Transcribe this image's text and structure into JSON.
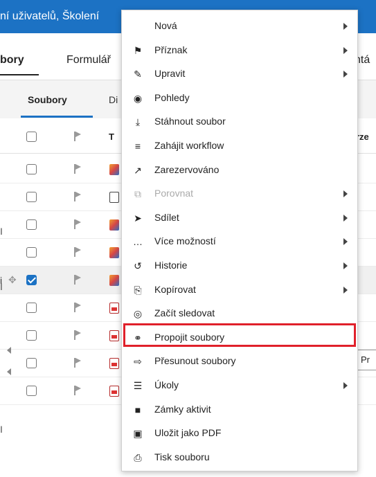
{
  "header": {
    "title": "ní uživatelů, Školení"
  },
  "main_tabs": [
    {
      "label": "bory"
    },
    {
      "label": "Formulář"
    },
    {
      "label": "ntá"
    }
  ],
  "sub_tabs": [
    {
      "label": "Soubory"
    },
    {
      "label": "Di"
    }
  ],
  "table": {
    "columns": [
      {
        "label": "T"
      },
      {
        "label": "rze"
      }
    ],
    "rows": [
      {
        "selected": false,
        "icon": "image-file-icon"
      },
      {
        "selected": false,
        "icon": "document-file-icon"
      },
      {
        "selected": false,
        "icon": "image-file-icon"
      },
      {
        "selected": false,
        "icon": "image-file-icon"
      },
      {
        "selected": true,
        "icon": "image-file-icon",
        "prefix": "i"
      },
      {
        "selected": false,
        "icon": "pdf-file-icon"
      },
      {
        "selected": false,
        "icon": "pdf-file-icon"
      },
      {
        "selected": false,
        "icon": "pdf-file-icon"
      },
      {
        "selected": false,
        "icon": "pdf-file-icon"
      }
    ],
    "side_letters": [
      "I",
      "I",
      "I"
    ],
    "tooltip_text": "Pr"
  },
  "context_menu": {
    "items": [
      {
        "label": "Nová",
        "icon": "",
        "submenu": true,
        "disabled": false
      },
      {
        "label": "Příznak",
        "icon": "flag-icon",
        "submenu": true,
        "disabled": false
      },
      {
        "label": "Upravit",
        "icon": "edit-icon",
        "submenu": true,
        "disabled": false
      },
      {
        "label": "Pohledy",
        "icon": "eye-icon",
        "submenu": false,
        "disabled": false
      },
      {
        "label": "Stáhnout soubor",
        "icon": "download-icon",
        "submenu": false,
        "disabled": false
      },
      {
        "label": "Zahájit workflow",
        "icon": "workflow-icon",
        "submenu": false,
        "disabled": false
      },
      {
        "label": "Zarezervováno",
        "icon": "checkout-icon",
        "submenu": false,
        "disabled": false
      },
      {
        "label": "Porovnat",
        "icon": "compare-icon",
        "submenu": true,
        "disabled": true
      },
      {
        "label": "Sdílet",
        "icon": "share-icon",
        "submenu": true,
        "disabled": false
      },
      {
        "label": "Více možností",
        "icon": "more-icon",
        "submenu": true,
        "disabled": false
      },
      {
        "label": "Historie",
        "icon": "history-icon",
        "submenu": true,
        "disabled": false
      },
      {
        "label": "Kopírovat",
        "icon": "copy-icon",
        "submenu": true,
        "disabled": false
      },
      {
        "label": "Začít sledovat",
        "icon": "follow-icon",
        "submenu": false,
        "disabled": false
      },
      {
        "label": "Propojit soubory",
        "icon": "link-icon",
        "submenu": false,
        "disabled": false,
        "highlighted": true
      },
      {
        "label": "Přesunout soubory",
        "icon": "move-file-icon",
        "submenu": false,
        "disabled": false
      },
      {
        "label": "Úkoly",
        "icon": "tasks-icon",
        "submenu": true,
        "disabled": false
      },
      {
        "label": "Zámky aktivit",
        "icon": "lock-icon",
        "submenu": false,
        "disabled": false
      },
      {
        "label": "Uložit jako PDF",
        "icon": "save-pdf-icon",
        "submenu": false,
        "disabled": false
      },
      {
        "label": "Tisk souboru",
        "icon": "print-icon",
        "submenu": false,
        "disabled": false
      }
    ],
    "highlight_color": "#e0202a"
  },
  "colors": {
    "header_blue": "#1c72c4",
    "checkbox_checked": "#1c72c4"
  }
}
